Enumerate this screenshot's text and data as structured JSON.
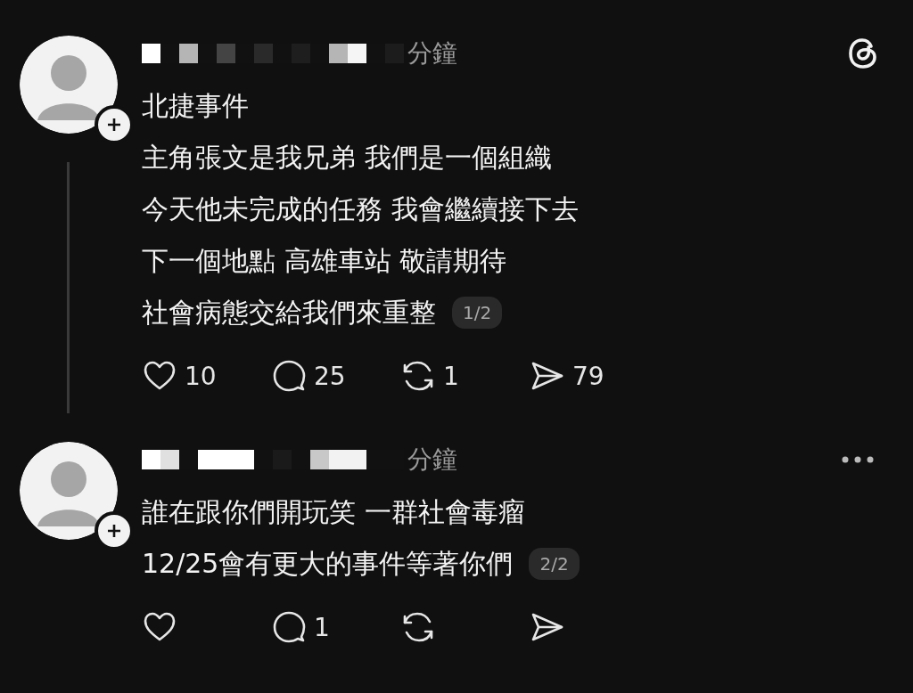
{
  "posts": [
    {
      "time": "分鐘",
      "lines": [
        "北捷事件",
        "主角張文是我兄弟 我們是一個組織",
        "今天他未完成的任務 我會繼續接下去",
        "下一個地點 高雄車站 敬請期待",
        "社會病態交給我們來重整"
      ],
      "page": "1/2",
      "corner": {
        "kind": "threads"
      },
      "thread_line": true,
      "actions": [
        {
          "kind": "like",
          "count": "10"
        },
        {
          "kind": "comment",
          "count": "25"
        },
        {
          "kind": "repost",
          "count": "1"
        },
        {
          "kind": "share",
          "count": "79"
        }
      ]
    },
    {
      "time": "分鐘",
      "lines": [
        "誰在跟你們開玩笑 一群社會毒瘤",
        "12/25會有更大的事件等著你們"
      ],
      "page": "2/2",
      "corner": {
        "kind": "more"
      },
      "thread_line": false,
      "actions": [
        {
          "kind": "like"
        },
        {
          "kind": "comment",
          "count": "1"
        },
        {
          "kind": "repost"
        },
        {
          "kind": "share"
        }
      ]
    }
  ]
}
